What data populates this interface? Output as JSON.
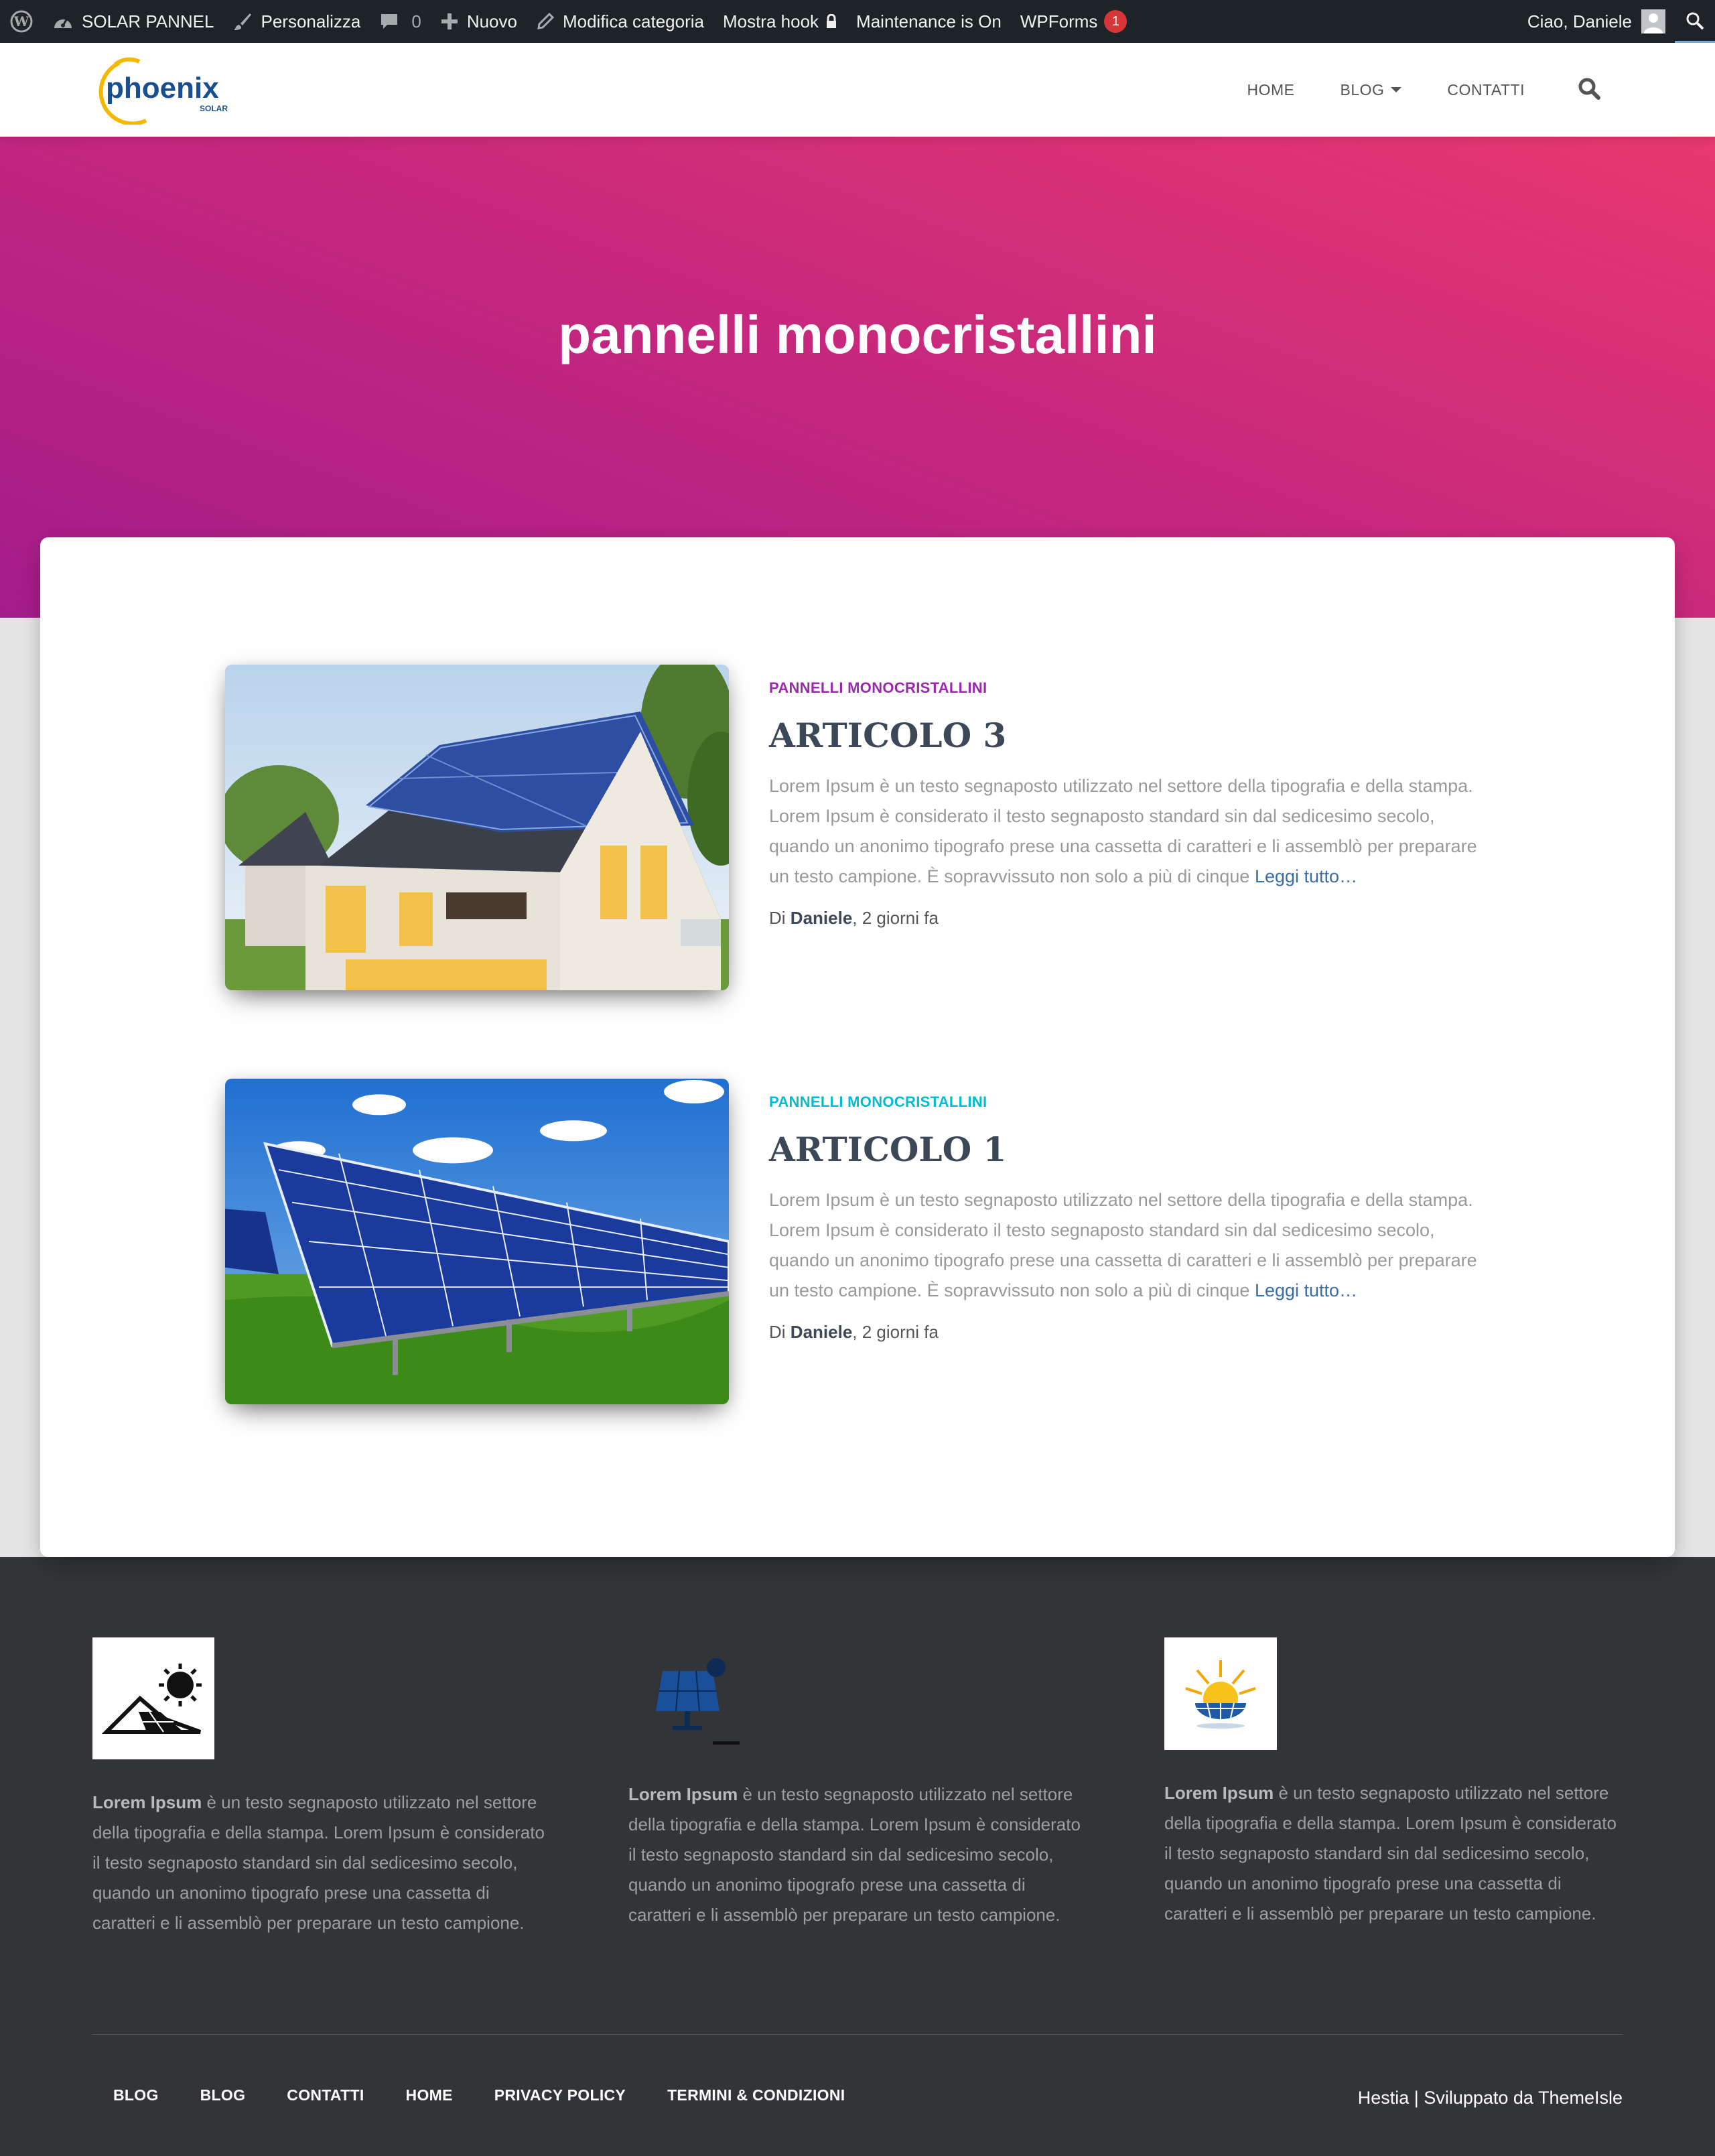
{
  "admin_bar": {
    "site_name": "SOLAR PANNEL",
    "customize": "Personalizza",
    "comments_count": "0",
    "new": "Nuovo",
    "edit_category": "Modifica categoria",
    "show_hooks": "Mostra hook",
    "maintenance": "Maintenance is On",
    "wpforms": "WPForms",
    "wpforms_badge": "1",
    "greeting": "Ciao, Daniele"
  },
  "logo": {
    "name": "phoenix",
    "sub": "SOLAR"
  },
  "nav": {
    "items": [
      "HOME",
      "BLOG",
      "CONTATTI"
    ]
  },
  "hero": {
    "title": "pannelli monocristallini"
  },
  "articles": [
    {
      "category": "PANNELLI MONOCRISTALLINI",
      "category_color": "#9c27b0",
      "title": "ARTICOLO 3",
      "excerpt": "Lorem Ipsum è un testo segnaposto utilizzato nel settore della tipografia e della stampa. Lorem Ipsum è considerato il testo segnaposto standard sin dal sedicesimo secolo, quando un anonimo tipografo prese una cassetta di caratteri e li assemblò per preparare un testo campione. È sopravvissuto non solo a più di cinque",
      "read_more": "Leggi tutto…",
      "meta_prefix": "Di",
      "author": "Daniele",
      "date": ", 2 giorni fa"
    },
    {
      "category": "PANNELLI MONOCRISTALLINI",
      "category_color": "#00bcd4",
      "title": "ARTICOLO 1",
      "excerpt": "Lorem Ipsum è un testo segnaposto utilizzato nel settore della tipografia e della stampa. Lorem Ipsum è considerato il testo segnaposto standard sin dal sedicesimo secolo, quando un anonimo tipografo prese una cassetta di caratteri e li assemblò per preparare un testo campione. È sopravvissuto non solo a più di cinque",
      "read_more": "Leggi tutto…",
      "meta_prefix": "Di",
      "author": "Daniele",
      "date": ", 2 giorni fa"
    }
  ],
  "footer": {
    "columns": [
      {
        "bold": "Lorem Ipsum",
        "text": " è un testo segnaposto utilizzato nel settore della tipografia e della stampa. Lorem Ipsum è considerato il testo segnaposto standard sin dal sedicesimo secolo, quando un anonimo tipografo prese una cassetta di caratteri e li assemblò per preparare un testo campione."
      },
      {
        "bold": "Lorem Ipsum",
        "text": " è un testo segnaposto utilizzato nel settore della tipografia e della stampa. Lorem Ipsum è considerato il testo segnaposto standard sin dal sedicesimo secolo, quando un anonimo tipografo prese una cassetta di caratteri e li assemblò per preparare un testo campione."
      },
      {
        "bold": "Lorem Ipsum",
        "text": " è un testo segnaposto utilizzato nel settore della tipografia e della stampa. Lorem Ipsum è considerato il testo segnaposto standard sin dal sedicesimo secolo, quando un anonimo tipografo prese una cassetta di caratteri e li assemblò per preparare un testo campione."
      }
    ],
    "menu": [
      "BLOG",
      "BLOG",
      "CONTATTI",
      "HOME",
      "PRIVACY POLICY",
      "TERMINI & CONDIZIONI"
    ],
    "copyright": "Hestia | Sviluppato da ThemeIsle"
  }
}
